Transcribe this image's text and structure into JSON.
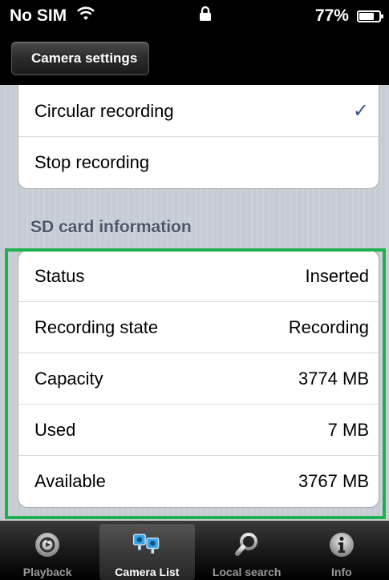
{
  "status_bar": {
    "carrier": "No SIM",
    "wifi_icon": "wifi-icon",
    "lock_icon": "lock-icon",
    "battery_percent": "77%",
    "battery_level": 0.77
  },
  "nav_bar": {
    "back_label": "Camera settings"
  },
  "recording_mode": {
    "options": [
      {
        "label": "Circular recording",
        "selected": true
      },
      {
        "label": "Stop recording",
        "selected": false
      }
    ],
    "checkmark": "✓"
  },
  "sd_card": {
    "header": "SD card information",
    "rows": [
      {
        "label": "Status",
        "value": "Inserted"
      },
      {
        "label": "Recording state",
        "value": "Recording"
      },
      {
        "label": "Capacity",
        "value": "3774 MB"
      },
      {
        "label": "Used",
        "value": "7 MB"
      },
      {
        "label": "Available",
        "value": "3767 MB"
      }
    ]
  },
  "tab_bar": {
    "tabs": [
      {
        "label": "Playback",
        "icon": "playback-icon",
        "active": false
      },
      {
        "label": "Camera List",
        "icon": "camera-list-icon",
        "active": true
      },
      {
        "label": "Local search",
        "icon": "search-icon",
        "active": false
      },
      {
        "label": "Info",
        "icon": "info-icon",
        "active": false
      }
    ]
  },
  "colors": {
    "highlight": "#1fb14e",
    "checkmark": "#385487",
    "section_header": "#4c566c"
  }
}
